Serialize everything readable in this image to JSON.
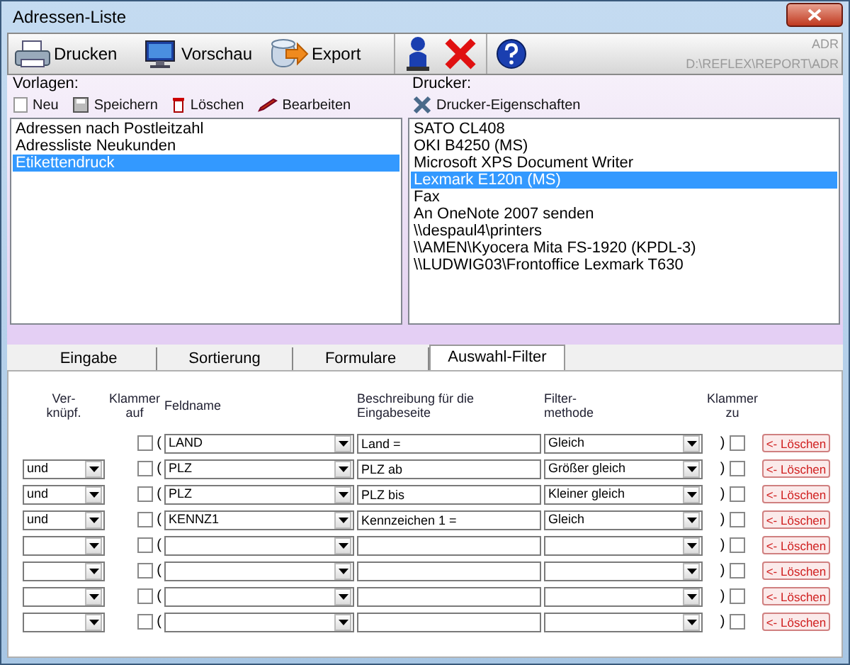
{
  "window": {
    "title": "Adressen-Liste"
  },
  "toolbar": {
    "buttons": [
      {
        "label": "Drucken",
        "kind": "printer"
      },
      {
        "label": "Vorschau",
        "kind": "monitor"
      },
      {
        "label": "Export",
        "kind": "export"
      }
    ],
    "path_top": "ADR",
    "path": "D:\\REFLEX\\REPORT\\ADR"
  },
  "templates": {
    "label": "Vorlagen:",
    "actions": [
      {
        "label": "Neu",
        "kind": "new"
      },
      {
        "label": "Speichern",
        "kind": "save"
      },
      {
        "label": "Löschen",
        "kind": "delete"
      },
      {
        "label": "Bearbeiten",
        "kind": "edit"
      }
    ],
    "items": [
      {
        "label": "Adressen nach Postleitzahl",
        "selected": false
      },
      {
        "label": "Adressliste Neukunden",
        "selected": false
      },
      {
        "label": "Etikettendruck",
        "selected": true
      }
    ]
  },
  "printers": {
    "label": "Drucker:",
    "actions": [
      {
        "label": "Drucker-Eigenschaften",
        "kind": "properties"
      }
    ],
    "items": [
      {
        "label": "SATO CL408",
        "selected": false
      },
      {
        "label": "OKI B4250 (MS)",
        "selected": false
      },
      {
        "label": "Microsoft XPS Document Writer",
        "selected": false
      },
      {
        "label": "Lexmark E120n (MS)",
        "selected": true
      },
      {
        "label": "Fax",
        "selected": false
      },
      {
        "label": "An OneNote 2007 senden",
        "selected": false
      },
      {
        "label": "\\\\despaul4\\printers",
        "selected": false
      },
      {
        "label": "\\\\AMEN\\Kyocera Mita FS-1920 (KPDL-3)",
        "selected": false
      },
      {
        "label": "\\\\LUDWIG03\\Frontoffice Lexmark T630",
        "selected": false
      }
    ]
  },
  "tabs": [
    {
      "label": "Eingabe",
      "selected": false
    },
    {
      "label": "Sortierung",
      "selected": false
    },
    {
      "label": "Formulare",
      "selected": false
    },
    {
      "label": "Auswahl-Filter",
      "selected": true
    }
  ],
  "filter": {
    "columns": [
      "Ver-\nknüpf.",
      "Klammer\nauf",
      "Feldname",
      "Beschreibung für die\nEingabeseite",
      "Filter-\nmethode",
      "Klammer\nzu"
    ],
    "rows": [
      {
        "link": null,
        "open_mark": "(",
        "open_checked": false,
        "field": "LAND",
        "description": "Land =",
        "method": "Gleich",
        "close_mark": ")",
        "close_checked": false,
        "delete": "<- Löschen"
      },
      {
        "link": "und",
        "open_mark": "(",
        "open_checked": false,
        "field": "PLZ",
        "description": "PLZ ab",
        "method": "Größer gleich",
        "close_mark": ")",
        "close_checked": false,
        "delete": "<- Löschen"
      },
      {
        "link": "und",
        "open_mark": "(",
        "open_checked": false,
        "field": "PLZ",
        "description": "PLZ bis",
        "method": "Kleiner gleich",
        "close_mark": ")",
        "close_checked": false,
        "delete": "<- Löschen"
      },
      {
        "link": "und",
        "open_mark": "(",
        "open_checked": false,
        "field": "KENNZ1",
        "description": "Kennzeichen 1 =",
        "method": "Gleich",
        "close_mark": ")",
        "close_checked": false,
        "delete": "<- Löschen"
      },
      {
        "link": "",
        "open_mark": "(",
        "open_checked": false,
        "field": "",
        "description": "",
        "method": "",
        "close_mark": ")",
        "close_checked": false,
        "delete": "<- Löschen"
      },
      {
        "link": "",
        "open_mark": "(",
        "open_checked": false,
        "field": "",
        "description": "",
        "method": "",
        "close_mark": ")",
        "close_checked": false,
        "delete": "<- Löschen"
      },
      {
        "link": "",
        "open_mark": "(",
        "open_checked": false,
        "field": "",
        "description": "",
        "method": "",
        "close_mark": ")",
        "close_checked": false,
        "delete": "<- Löschen"
      },
      {
        "link": "",
        "open_mark": "(",
        "open_checked": false,
        "field": "",
        "description": "",
        "method": "",
        "close_mark": ")",
        "close_checked": false,
        "delete": "<- Löschen"
      }
    ]
  }
}
